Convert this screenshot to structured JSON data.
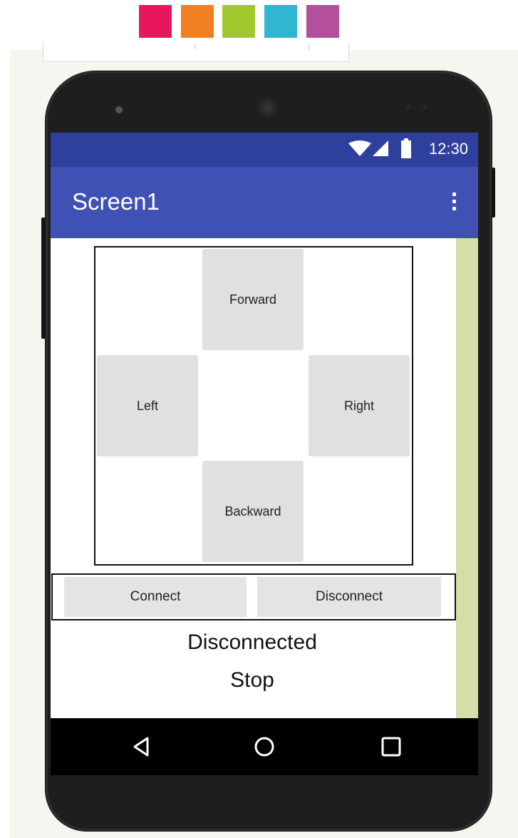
{
  "palette": {
    "swatches": [
      "#e8175d",
      "#f0801f",
      "#a3c82d",
      "#31b6d2",
      "#b34f9b"
    ]
  },
  "statusbar": {
    "time": "12:30",
    "icons": [
      "wifi-icon",
      "signal-icon",
      "battery-icon"
    ]
  },
  "appbar": {
    "title": "Screen1",
    "menu_icon": "overflow-menu-icon"
  },
  "dpad": {
    "forward_label": "Forward",
    "left_label": "Left",
    "right_label": "Right",
    "backward_label": "Backward"
  },
  "connection": {
    "connect_label": "Connect",
    "disconnect_label": "Disconnect"
  },
  "labels": {
    "connection_status": "Disconnected",
    "movement_status": "Stop"
  },
  "navbar": {
    "icons": [
      "back-icon",
      "home-icon",
      "recents-icon"
    ]
  },
  "colors": {
    "statusbar": "#2f3f9d",
    "appbar": "#3f51b5",
    "scroll_strip": "#d3dfa6",
    "button_gray": "#e0e0e0"
  }
}
